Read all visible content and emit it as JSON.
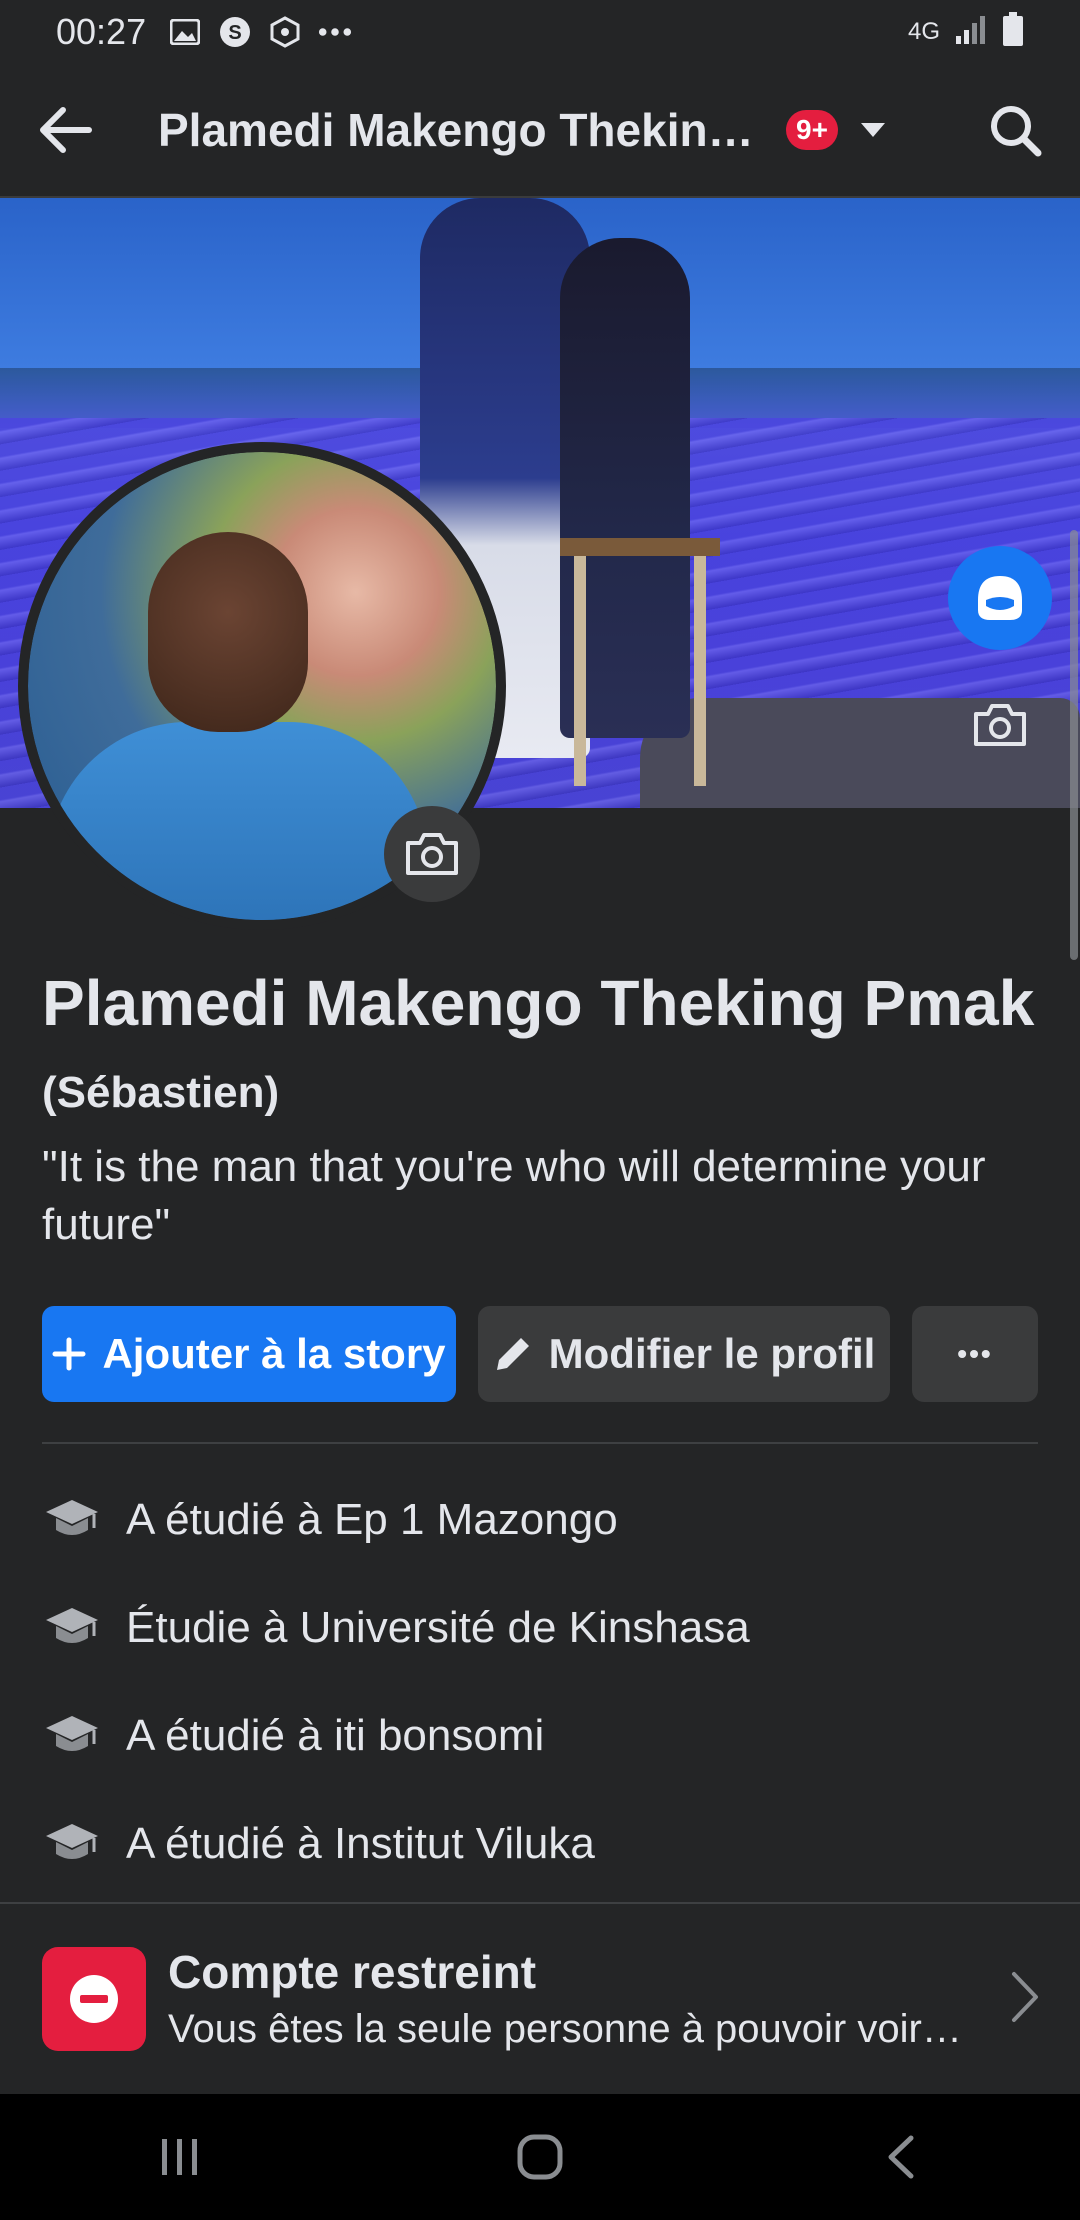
{
  "status_bar": {
    "time": "00:27",
    "network": "4G",
    "icons": [
      "image-icon",
      "s-icon",
      "hexagon-icon",
      "more-dots-icon"
    ]
  },
  "top_nav": {
    "title": "Plamedi Makengo Theking Pmak",
    "badge": "9+"
  },
  "profile": {
    "name": "Plamedi Makengo Theking Pmak",
    "alternate_name": "(Sébastien)",
    "bio": "\"It is the man that you're who will determine your future\""
  },
  "actions": {
    "add_story": "Ajouter à la story",
    "edit_profile": "Modifier le profil",
    "more": "•••"
  },
  "education": [
    {
      "label": "A étudié à Ep 1 Mazongo"
    },
    {
      "label": "Étudie à Université de Kinshasa"
    },
    {
      "label": "A étudié à iti bonsomi"
    },
    {
      "label": "A étudié à Institut Viluka"
    }
  ],
  "restricted": {
    "title": "Compte restreint",
    "description": "Vous êtes la seule personne à pouvoir voir ce profil."
  },
  "colors": {
    "background": "#242526",
    "accent": "#1877f2",
    "badge": "#e41e3f",
    "button_secondary": "#3a3b3c",
    "text": "#e4e6eb"
  }
}
